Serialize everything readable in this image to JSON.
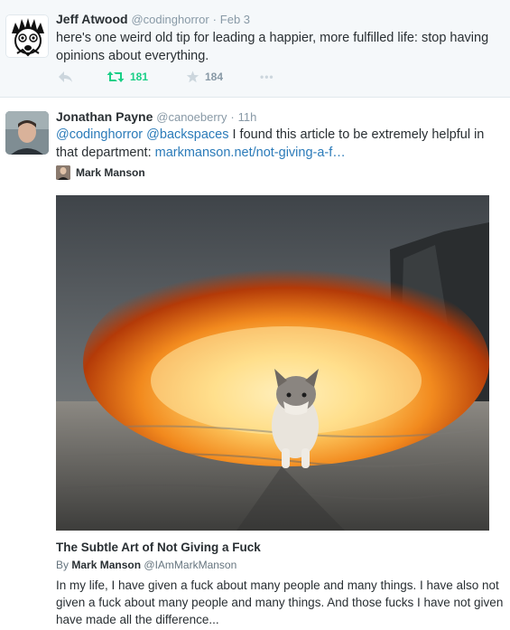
{
  "tweets": [
    {
      "author_name": "Jeff Atwood",
      "handle": "@codinghorror",
      "separator": "·",
      "time": "Feb 3",
      "text": "here's one weird old tip for leading a happier, more fulfilled life: stop having opinions about everything.",
      "retweet_count": "181",
      "favorite_count": "184",
      "more_label": "•••"
    },
    {
      "author_name": "Jonathan Payne",
      "handle": "@canoeberry",
      "separator": "·",
      "time": "11h",
      "mention_1": "@codinghorror",
      "mention_2": "@backspaces",
      "text_body": " I found this article to be extremely helpful in that department: ",
      "link_text": "markmanson.net/not-giving-a-f…",
      "card": {
        "source_name": "Mark Manson",
        "title": "The Subtle Art of Not Giving a Fuck",
        "by_prefix": "By",
        "by_name": "Mark Manson",
        "by_handle": "@IAmMarkManson",
        "description": "In my life, I have given a fuck about many people and many things. I have also not given a fuck about many people and many things. And those fucks I have not given have made all the difference..."
      }
    }
  ],
  "icons": {
    "reply": "reply-icon",
    "retweet": "retweet-icon",
    "favorite": "star-icon",
    "more": "more-icon"
  },
  "colors": {
    "link": "#2b7bb9",
    "retweet_active": "#19cf86",
    "muted": "#8899a6"
  }
}
